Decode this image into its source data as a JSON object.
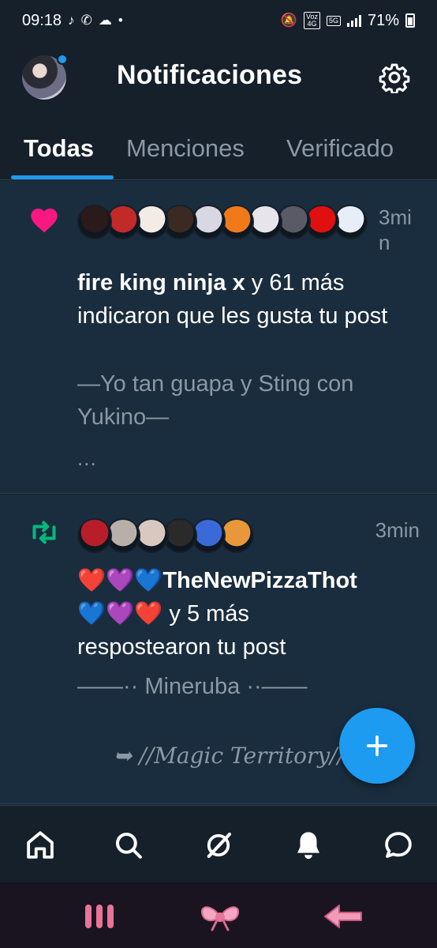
{
  "status_bar": {
    "time": "09:18",
    "network_top": "Voz",
    "network_bottom": "4G",
    "network2": "5G",
    "battery": "71%"
  },
  "header": {
    "title": "Notificaciones"
  },
  "tabs": [
    {
      "label": "Todas",
      "active": true
    },
    {
      "label": "Menciones",
      "active": false
    },
    {
      "label": "Verificado",
      "active": false
    }
  ],
  "notifications": [
    {
      "type": "like",
      "icon": "heart-icon",
      "time": "3min",
      "user": "fire king ninja x",
      "action": " y 61 más indicaron que les gusta tu post",
      "quote": "—Yo tan guapa y Sting con Yukino—",
      "more": "...",
      "avatar_colors": [
        "#2a1a1a",
        "#c22a2a",
        "#f2ece4",
        "#3a2a22",
        "#d8d8e4",
        "#f07a1a",
        "#e8e4ec",
        "#5a5a66",
        "#e01010",
        "#e8eef8"
      ]
    },
    {
      "type": "repost",
      "icon": "repost-icon",
      "time": "3min",
      "user_line1": "❤️💜💙TheNewPizzaThot",
      "user_line2": "💙💜❤️",
      "action": " y 5 más",
      "action2": "respostearon tu post",
      "quote": "——·· Mineruba ··——",
      "quote2": "➥ //Magic Territory//",
      "avatar_colors": [
        "#b81e2a",
        "#b8b0a8",
        "#d8c8c0",
        "#2a2a2a",
        "#3a6ad8",
        "#e8983a"
      ]
    }
  ],
  "fab": {
    "label": "+"
  },
  "bottom_nav": [
    "home-icon",
    "search-icon",
    "grok-icon",
    "bell-icon",
    "messages-icon"
  ],
  "system_nav": [
    "recents-icon",
    "home-bow-icon",
    "back-icon"
  ],
  "colors": {
    "accent": "#1d9bf0",
    "background": "#15202b",
    "like": "#f91880",
    "repost": "#00ba7c",
    "muted": "#8b98a5"
  }
}
